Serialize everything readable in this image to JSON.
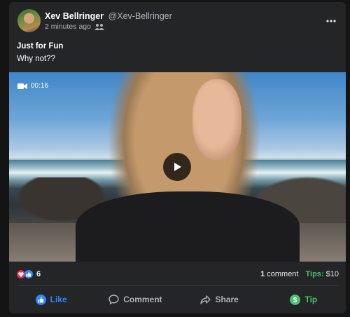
{
  "post": {
    "author_name": "Xev Bellringer",
    "author_handle": "@Xev-Bellringer",
    "timestamp": "2 minutes ago",
    "title": "Just for Fun",
    "body": "Why not??"
  },
  "video": {
    "duration": "00:16"
  },
  "stats": {
    "reaction_count": "6",
    "comment_count": "1",
    "comment_label": "comment",
    "tips_label": "Tips:",
    "tips_value": "$10"
  },
  "actions": {
    "like": "Like",
    "comment": "Comment",
    "share": "Share",
    "tip": "Tip"
  },
  "colors": {
    "background": "#141414",
    "card": "#242526",
    "like_blue": "#2d88ff",
    "tip_green": "#4bbf73"
  },
  "icons": {
    "privacy": "group-icon",
    "video": "video-camera-icon",
    "play": "play-icon",
    "more": "more-options-icon"
  }
}
